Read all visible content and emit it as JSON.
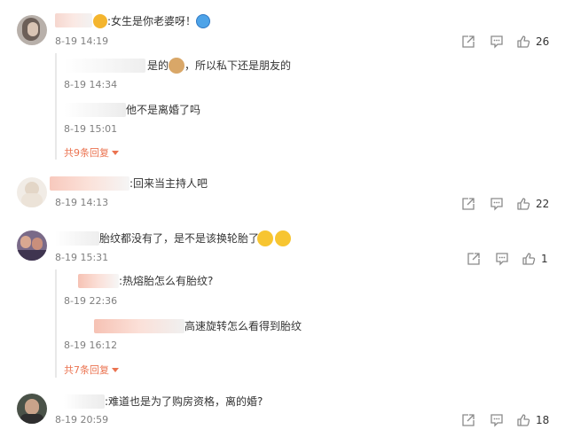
{
  "comments": [
    {
      "text": ":女生是你老婆呀！",
      "time": "8-19 14:19",
      "likes": "26",
      "replies": [
        {
          "text": "是的",
          "text_after_emoji": "，所以私下还是朋友的",
          "time": "8-19 14:34"
        },
        {
          "text": "他不是离婚了吗",
          "time": "8-19 15:01"
        }
      ],
      "more_replies": "共9条回复"
    },
    {
      "text": ":回来当主持人吧",
      "time": "8-19 14:13",
      "likes": "22"
    },
    {
      "text": "胎纹都没有了，是不是该换轮胎了",
      "time": "8-19 15:31",
      "likes": "1",
      "replies": [
        {
          "text": ":热熔胎怎么有胎纹?",
          "time": "8-19 22:36"
        },
        {
          "text": "高速旋转怎么看得到胎纹",
          "time": "8-19 16:12"
        }
      ],
      "more_replies": "共7条回复"
    },
    {
      "text": ":难道也是为了购房资格，离的婚?",
      "time": "8-19 20:59",
      "likes": "18"
    }
  ],
  "colors": {
    "link_orange": "#eb7350",
    "time_gray": "#808080",
    "icon_gray": "#8a8a8a",
    "reply_bg": "#f8f8f8"
  },
  "icons": [
    "share-icon",
    "comment-icon",
    "like-icon",
    "emoji-icon"
  ]
}
